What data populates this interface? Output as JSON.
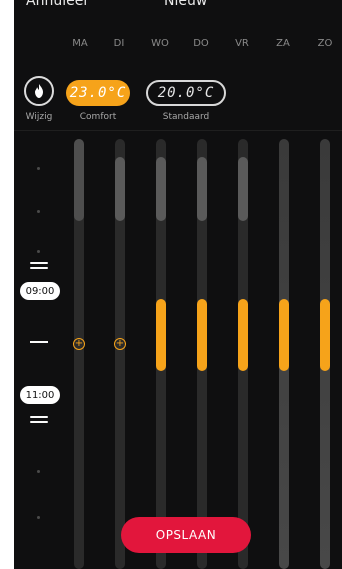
{
  "header": {
    "left_label": "Annuleer",
    "center_label": "Nieuw"
  },
  "days": [
    "MA",
    "DI",
    "WO",
    "DO",
    "VR",
    "ZA",
    "ZO"
  ],
  "controls": {
    "change_label": "Wijzig",
    "comfort_temp": "23.0°C",
    "comfort_label": "Comfort",
    "standard_temp": "20.0°C",
    "standard_label": "Standaard"
  },
  "time_start": "09:00",
  "time_end": "11:00",
  "save_label": "OPSLAAN",
  "colors": {
    "accent": "#f6a31a",
    "save": "#e2163c"
  }
}
